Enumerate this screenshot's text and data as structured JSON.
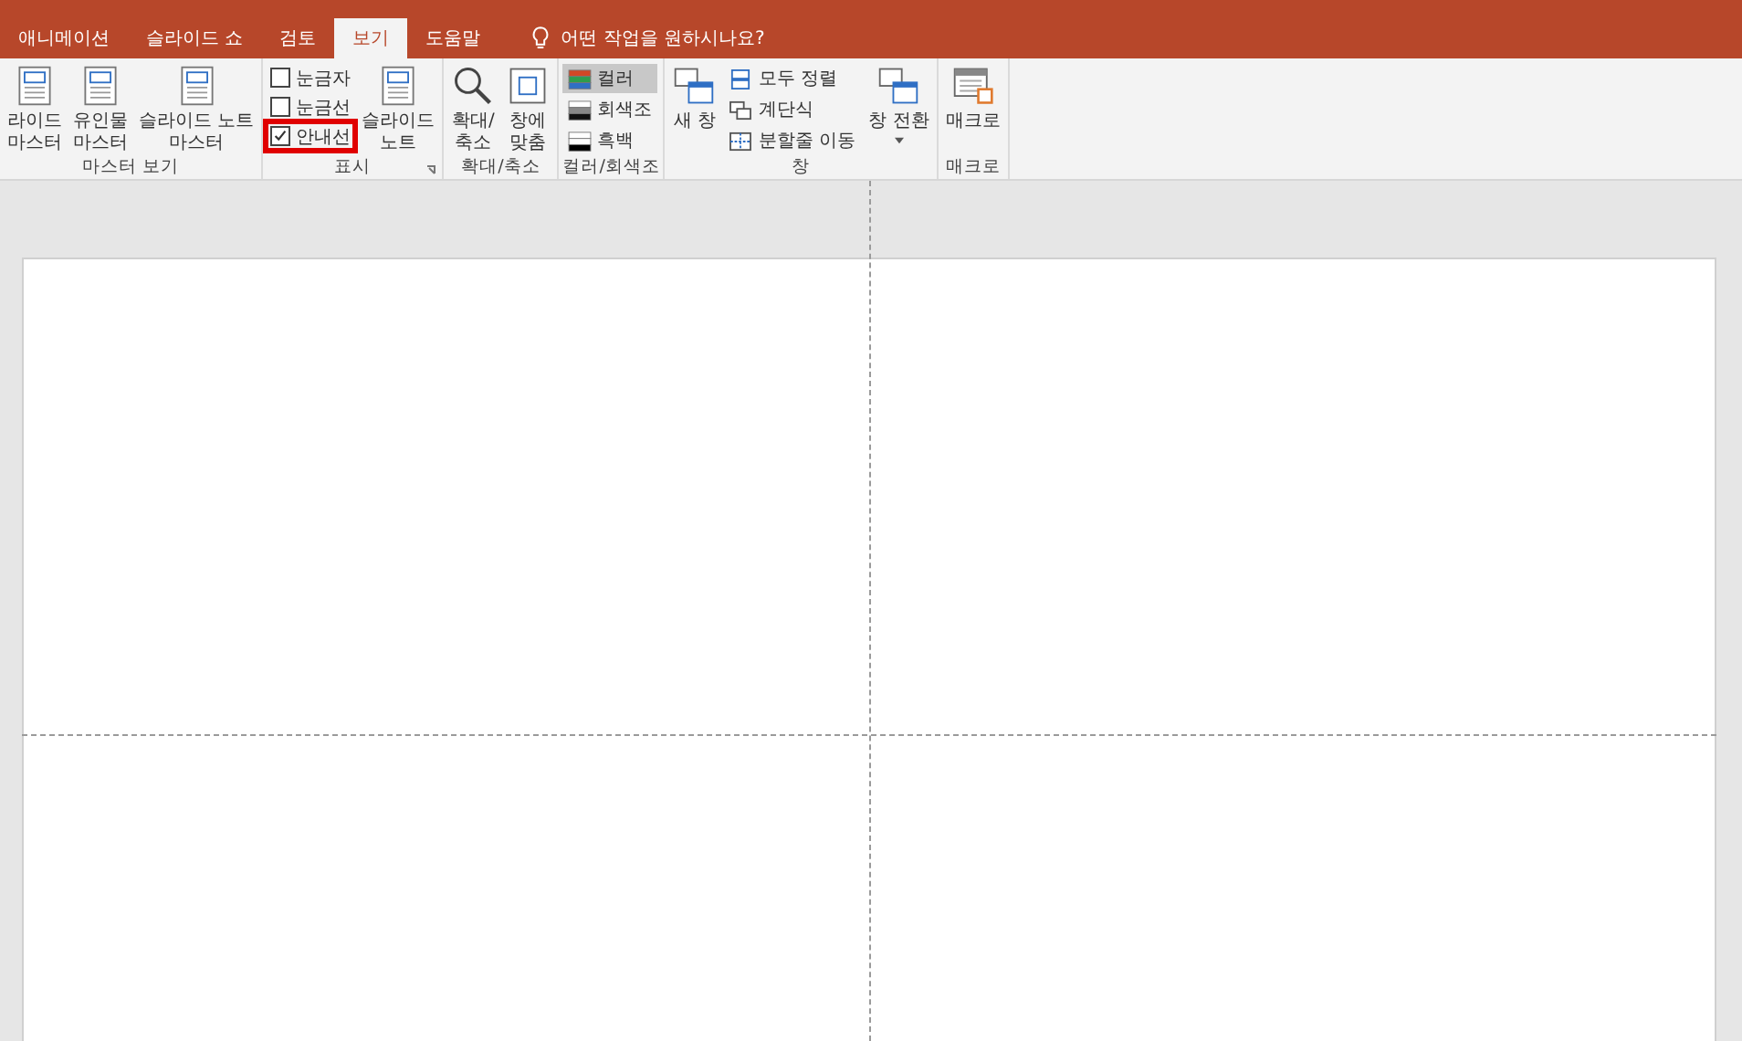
{
  "tabs": [
    {
      "label": "애니메이션",
      "selected": false
    },
    {
      "label": "슬라이드 쇼",
      "selected": false
    },
    {
      "label": "검토",
      "selected": false
    },
    {
      "label": "보기",
      "selected": true
    },
    {
      "label": "도움말",
      "selected": false
    }
  ],
  "tell_me": "어떤 작업을 원하시나요?",
  "ribbon": {
    "groups": [
      {
        "label": "마스터 보기",
        "columns": [
          [
            {
              "kind": "large",
              "lines": [
                "라이드",
                "마스터"
              ]
            }
          ],
          [
            {
              "kind": "large",
              "lines": [
                "유인물",
                "마스터"
              ]
            }
          ],
          [
            {
              "kind": "large",
              "lines": [
                "슬라이드 노트",
                "마스터"
              ]
            }
          ]
        ]
      },
      {
        "label": "표시",
        "launcher": true,
        "columns": [
          [
            {
              "kind": "check",
              "label": "눈금자",
              "checked": false,
              "highlighted": false
            },
            {
              "kind": "check",
              "label": "눈금선",
              "checked": false,
              "highlighted": false
            },
            {
              "kind": "check",
              "label": "안내선",
              "checked": true,
              "highlighted": true
            }
          ],
          [
            {
              "kind": "large",
              "lines": [
                "슬라이드",
                "노트"
              ]
            }
          ]
        ]
      },
      {
        "label": "확대/축소",
        "columns": [
          [
            {
              "kind": "large",
              "lines": [
                "확대/",
                "축소"
              ]
            }
          ],
          [
            {
              "kind": "large",
              "lines": [
                "창에",
                "맞춤"
              ]
            }
          ]
        ]
      },
      {
        "label": "컬러/회색조",
        "columns": [
          [
            {
              "kind": "swatch",
              "label": "컬러",
              "selected": true
            },
            {
              "kind": "swatch",
              "label": "회색조",
              "selected": false
            },
            {
              "kind": "swatch",
              "label": "흑백",
              "selected": false
            }
          ]
        ]
      },
      {
        "label": "창",
        "columns": [
          [
            {
              "kind": "large",
              "lines": [
                "새 창"
              ]
            }
          ],
          [
            {
              "kind": "small",
              "label": "모두 정렬"
            },
            {
              "kind": "small",
              "label": "계단식"
            },
            {
              "kind": "small",
              "label": "분할줄 이동"
            }
          ],
          [
            {
              "kind": "large",
              "lines": [
                "창 전환"
              ],
              "dropdown": true
            }
          ]
        ]
      },
      {
        "label": "매크로",
        "columns": [
          [
            {
              "kind": "large",
              "lines": [
                "매크로"
              ]
            }
          ]
        ]
      }
    ]
  },
  "slide": {
    "guides": true
  }
}
